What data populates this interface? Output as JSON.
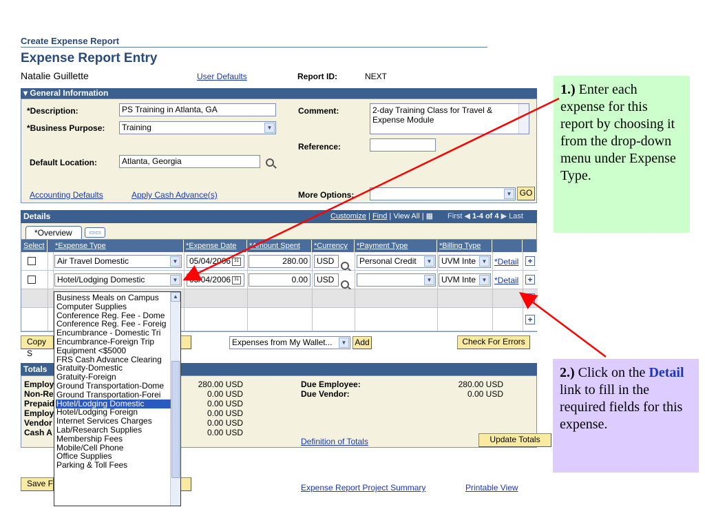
{
  "breadcrumb": "Create Expense Report",
  "page_title": "Expense Report Entry",
  "user_name": "Natalie Guillette",
  "user_defaults_link": "User Defaults",
  "report_id": {
    "label": "Report ID:",
    "value": "NEXT"
  },
  "general_info": {
    "section_title": "General Information",
    "description_label": "*Description:",
    "description_value": "PS Training in Atlanta, GA",
    "business_purpose_label": "*Business Purpose:",
    "business_purpose_value": "Training",
    "default_location_label": "Default Location:",
    "default_location_value": "Atlanta, Georgia",
    "comment_label": "Comment:",
    "comment_value_line1": "2-day Training Class for Travel &",
    "comment_value_line2": "Expense Module",
    "reference_label": "Reference:",
    "accounting_defaults_link": "Accounting Defaults",
    "apply_cash_advance_link": "Apply Cash Advance(s)",
    "more_options_label": "More Options:",
    "go_button": "GO"
  },
  "details": {
    "section_title": "Details",
    "customize_link": "Customize",
    "find_link": "Find",
    "view_all": "View All",
    "first": "First",
    "range": "1-4 of 4",
    "last": "Last",
    "tab_overview": "*Overview",
    "columns": [
      "Select",
      "*Expense Type",
      "*Expense Date",
      "*Amount Spent",
      "*Currency",
      "*Payment Type",
      "*Billing Type"
    ],
    "rows": [
      {
        "expense_type": "Air Travel Domestic",
        "date": "05/04/2006",
        "amount": "280.00",
        "currency": "USD",
        "payment_type": "Personal Credit",
        "billing_type": "UVM Inte",
        "detail": "*Detail"
      },
      {
        "expense_type": "Hotel/Lodging Domestic",
        "date": "05/04/2006",
        "amount": "0.00",
        "currency": "USD",
        "payment_type": "",
        "billing_type": "UVM Inte",
        "detail": "*Detail"
      }
    ],
    "copy_button": "Copy S",
    "wallet_select": "Expenses from My Wallet...",
    "add_button": "Add",
    "check_errors_button": "Check For Errors"
  },
  "expense_type_options": [
    "Business Meals on Campus",
    "Computer Supplies",
    "Conference Reg. Fee - Dome",
    "Conference Reg. Fee - Foreig",
    "Encumbrance - Domestic Tri",
    "Encumbrance-Foreign Trip",
    "Equipment <$5000",
    "FRS Cash Advance Clearing",
    "Gratuity-Domestic",
    "Gratuity-Foreign",
    "Ground Transportation-Dome",
    "Ground Transportation-Forei",
    "Hotel/Lodging Domestic",
    "Hotel/Lodging Foreign",
    "Internet Services Charges",
    "Lab/Research Supplies",
    "Membership Fees",
    "Mobile/Cell Phone",
    "Office Supplies",
    "Parking & Toll Fees"
  ],
  "totals": {
    "section_title": "Totals",
    "labels": [
      "Employ",
      "Non-Rei",
      "Prepaid",
      "Employ",
      "Vendor",
      "Cash A"
    ],
    "values": [
      "280.00 USD",
      "0.00 USD",
      "0.00 USD",
      "0.00 USD",
      "0.00 USD",
      "0.00 USD"
    ],
    "due_employee_label": "Due Employee:",
    "due_employee_value": "280.00 USD",
    "due_vendor_label": "Due Vendor:",
    "due_vendor_value": "0.00 USD",
    "definition_link": "Definition of Totals",
    "update_totals_button": "Update Totals"
  },
  "footer": {
    "save_button": "Save F",
    "project_summary_link": "Expense Report Project Summary",
    "printable_view_link": "Printable View"
  },
  "callout1": {
    "number": "1.)",
    "text": "Enter each expense for this report by choosing it from the drop-down menu under Expense Type.",
    "bg": "#ccffcc"
  },
  "callout2": {
    "number": "2.)",
    "text_a": "Click on the",
    "bold": "Detail",
    "text_b": "link to fill in the required fields for this expense.",
    "bg": "#ddccff"
  },
  "colors": {
    "header_bar": "#3b5f8f",
    "link": "#1a38b3",
    "button": "#f8eaa0",
    "arrow": "#ff0000"
  }
}
